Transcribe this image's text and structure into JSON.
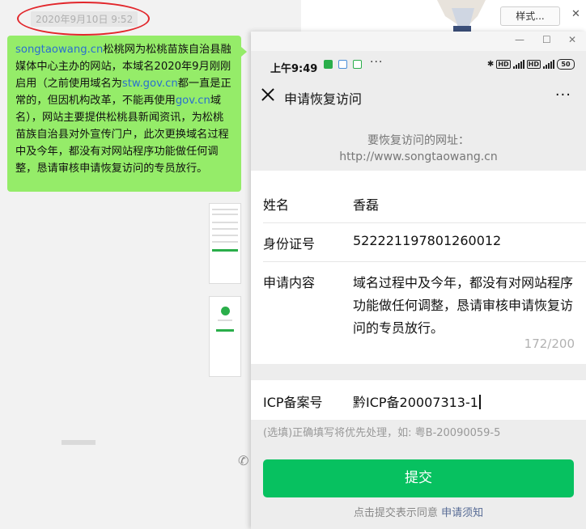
{
  "chat": {
    "timestamp": "2020年9月10日 9:52",
    "message": {
      "domain1": "songtaowang.cn",
      "text1": "松桃网为松桃苗族自治县融媒体中心主办的网站，本域名2020年9月刚刚启用（之前使用域名为",
      "domain2": "stw.gov.cn",
      "text2": "都一直是正常的，但因机构改革，不能再使用",
      "domain3": "gov.cn",
      "text3": "域名），网站主要提供松桃县新闻资讯，为松桃苗族自治县对外宣传门户，此次更换域名过程中及今年，都没有对网站程序功能做任何调整，恳请审核申请恢复访问的专员放行。"
    }
  },
  "background_page": {
    "format_button": "样式..."
  },
  "phone": {
    "status_bar": {
      "time": "上午9:49",
      "dots": "···",
      "battery": "50"
    },
    "title": "申请恢复访问",
    "more": "···",
    "url_label": "要恢复访问的网址：",
    "url_value": "http://www.songtaowang.cn",
    "form": {
      "name_label": "姓名",
      "name_value": "香磊",
      "id_label": "身份证号",
      "id_value": "522221197801260012",
      "content_label": "申请内容",
      "content_value": "域名过程中及今年，都没有对网站程序功能做任何调整，恳请审核申请恢复访问的专员放行。",
      "counter": "172/200",
      "icp_label": "ICP备案号",
      "icp_value": "黔ICP备20007313-1"
    },
    "hint": "(选填)正确填写将优先处理，如: 粤B-20090059-5",
    "submit": "提交",
    "agree_prefix": "点击提交表示同意",
    "agree_link": "申请须知"
  }
}
